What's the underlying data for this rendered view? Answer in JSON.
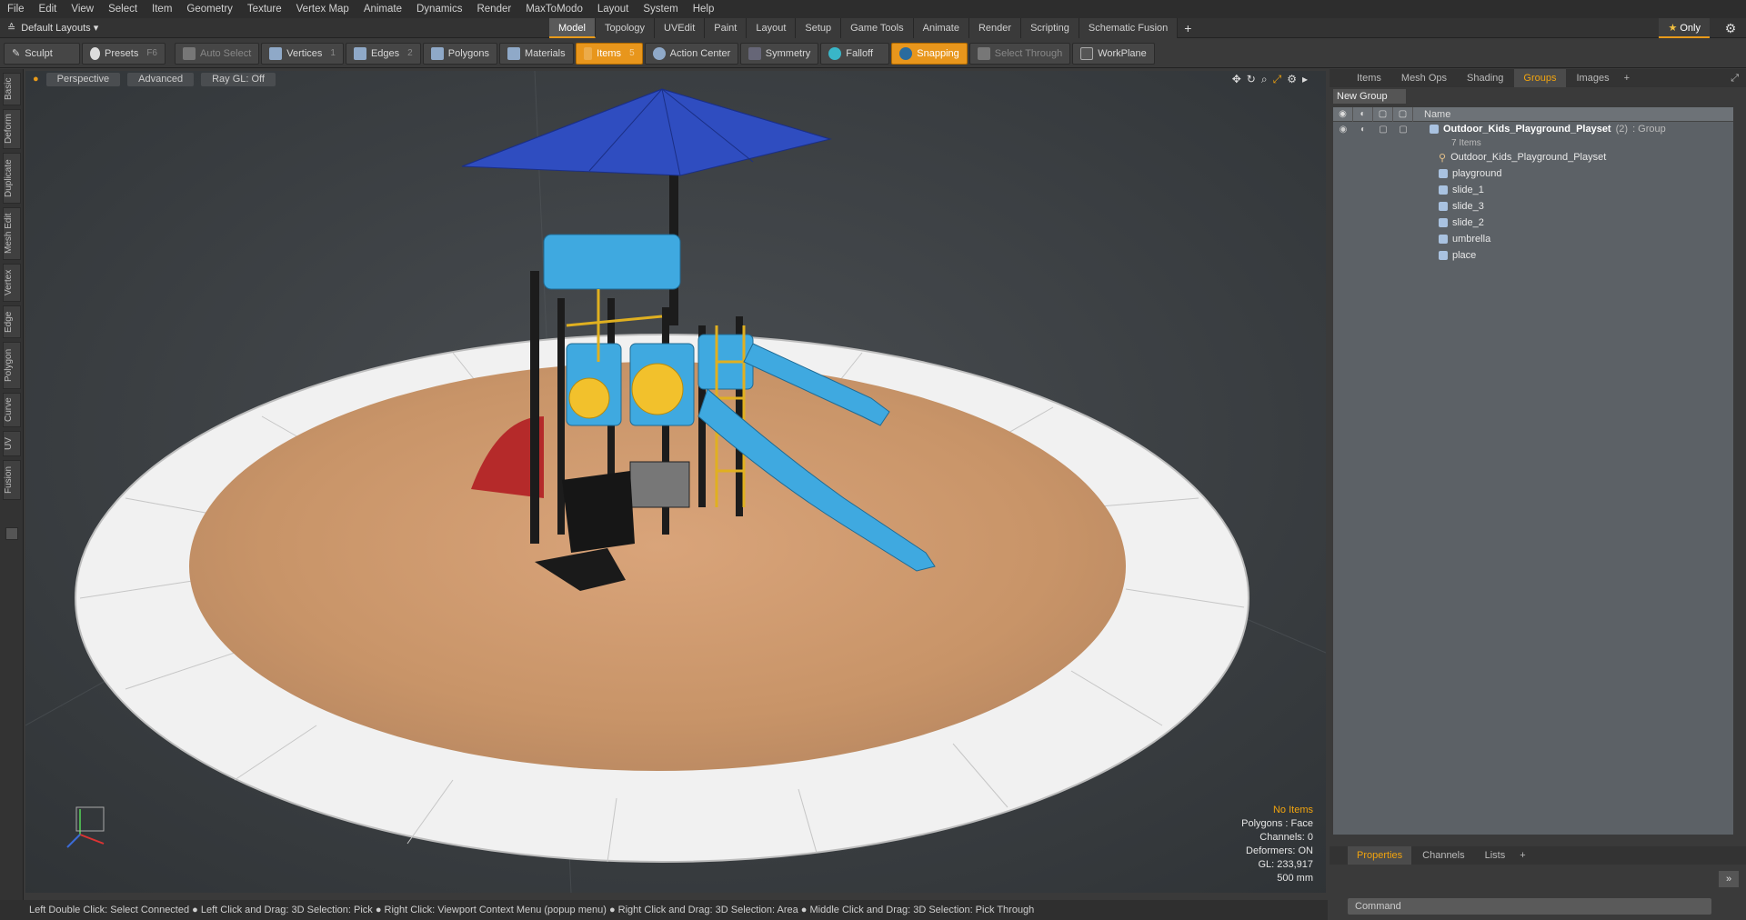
{
  "menu": [
    "File",
    "Edit",
    "View",
    "Select",
    "Item",
    "Geometry",
    "Texture",
    "Vertex Map",
    "Animate",
    "Dynamics",
    "Render",
    "MaxToModo",
    "Layout",
    "System",
    "Help"
  ],
  "layouts_label": "Default Layouts ▾",
  "mode_tabs": [
    "Model",
    "Topology",
    "UVEdit",
    "Paint",
    "Layout",
    "Setup",
    "Game Tools",
    "Animate",
    "Render",
    "Scripting",
    "Schematic Fusion"
  ],
  "only_label": "Only",
  "toolbar": {
    "sculpt": "Sculpt",
    "presets": "Presets",
    "presets_key": "F6",
    "auto_select": "Auto Select",
    "vertices": "Vertices",
    "vertices_count": "1",
    "edges": "Edges",
    "edges_count": "2",
    "polygons": "Polygons",
    "materials": "Materials",
    "items": "Items",
    "items_count": "5",
    "action_center": "Action Center",
    "symmetry": "Symmetry",
    "falloff": "Falloff",
    "snapping": "Snapping",
    "select_through": "Select Through",
    "workplane": "WorkPlane"
  },
  "left_tabs": [
    "Basic",
    "Deform",
    "Duplicate",
    "Mesh Edit",
    "Vertex",
    "Edge",
    "Polygon",
    "Curve",
    "UV",
    "Fusion"
  ],
  "viewport": {
    "view": "Perspective",
    "advanced": "Advanced",
    "raygl": "Ray GL: Off",
    "info": {
      "no_items": "No Items",
      "polygons": "Polygons : Face",
      "channels": "Channels: 0",
      "deformers": "Deformers: ON",
      "gl": "GL: 233,917",
      "scale": "500 mm"
    }
  },
  "status_text": "Left Double Click: Select Connected ● Left Click and Drag: 3D Selection: Pick ● Right Click: Viewport Context Menu (popup menu) ● Right Click and Drag: 3D Selection: Area ● Middle Click and Drag: 3D Selection: Pick Through",
  "right_panel": {
    "tabs": [
      "Items",
      "Mesh Ops",
      "Shading",
      "Groups",
      "Images"
    ],
    "active_tab": "Groups",
    "new_group": "New Group",
    "col_name": "Name",
    "group_name": "Outdoor_Kids_Playground_Playset",
    "group_count": "(2)",
    "group_type": ": Group",
    "group_items": "7 Items",
    "children": [
      "Outdoor_Kids_Playground_Playset",
      "playground",
      "slide_1",
      "slide_3",
      "slide_2",
      "umbrella",
      "place"
    ],
    "bottom_tabs": [
      "Properties",
      "Channels",
      "Lists"
    ],
    "command_placeholder": "Command"
  }
}
